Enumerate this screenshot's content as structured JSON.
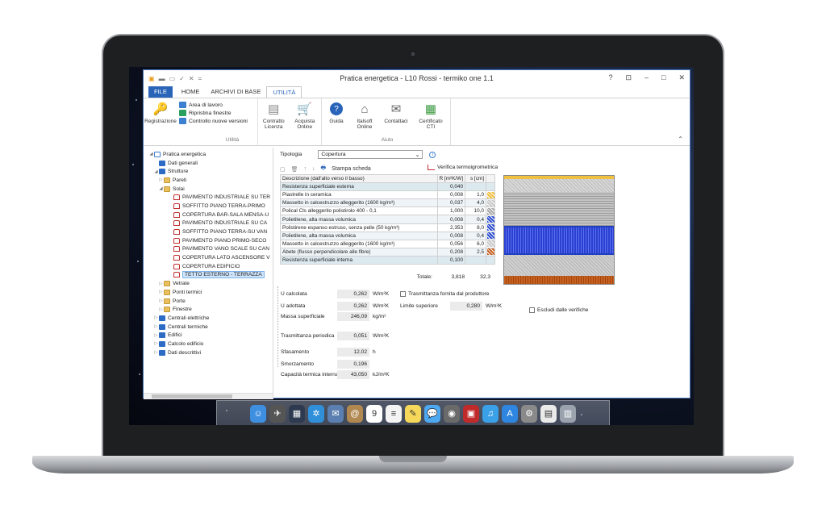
{
  "window": {
    "title": "Pratica energetica - L10 Rossi - termiko one 1.1",
    "controls": [
      "?",
      "⊡",
      "–",
      "□",
      "✕"
    ]
  },
  "quick_access": [
    "▣",
    "▬",
    "▭",
    "✓",
    "✕",
    "="
  ],
  "tabs": [
    {
      "label": "FILE"
    },
    {
      "label": "HOME"
    },
    {
      "label": "ARCHIVI DI BASE"
    },
    {
      "label": "UTILITÀ"
    }
  ],
  "ribbon": {
    "utilita_group": {
      "label": "Utilità",
      "registrazione": "Registrazione",
      "area_di_lavoro": "Area di lavoro",
      "ripristina_finestre": "Ripristina finestre",
      "controllo_nuove_versioni": "Controllo nuove versioni",
      "contratto_licenza": "Contratto Licenza",
      "acquista_online": "Acquista Online"
    },
    "aiuto_group": {
      "label": "Aiuto",
      "guida": "Guida",
      "italsoft_online": "Italsoft Online",
      "contattaci": "Contattaci",
      "certificato_cti": "Certificato CTI"
    }
  },
  "tree": [
    {
      "label": "Pratica energetica",
      "icon": "doc-icon",
      "arrow": "◢"
    },
    {
      "label": "Dati generali",
      "icon": "blue-book-icon",
      "arrow": ""
    },
    {
      "label": "Strutture",
      "icon": "blue-book-icon",
      "arrow": "◢"
    },
    {
      "label": "Pareti",
      "icon": "folder-icon",
      "arrow": "▷"
    },
    {
      "label": "Solai",
      "icon": "folder-icon",
      "arrow": "◢"
    },
    {
      "label": "PAVIMENTO INDUSTRIALE SU TER",
      "icon": "slab-icon",
      "arrow": ""
    },
    {
      "label": "SOFFITTO PIANO TERRA-PRIMO",
      "icon": "slab-icon",
      "arrow": ""
    },
    {
      "label": "COPERTURA BAR-SALA MENSA-U",
      "icon": "slab-icon",
      "arrow": ""
    },
    {
      "label": "PAVIMENTO INDUSTRIALE SU CA",
      "icon": "slab-icon",
      "arrow": ""
    },
    {
      "label": "SOFFITTO PIANO TERRA-SU VAN",
      "icon": "slab-icon",
      "arrow": ""
    },
    {
      "label": "PAVIMENTO PIANO PRIMO-SECO",
      "icon": "slab-icon",
      "arrow": ""
    },
    {
      "label": "PAVIMENTO VANO SCALE SU CAN",
      "icon": "slab-icon",
      "arrow": ""
    },
    {
      "label": "COPERTURA LATO ASCENSORE V",
      "icon": "slab-icon",
      "arrow": ""
    },
    {
      "label": "COPERTURA EDIFICIO",
      "icon": "slab-icon",
      "arrow": ""
    },
    {
      "label": "TETTO ESTERNO - TERRAZZA",
      "icon": "slab-icon",
      "arrow": "",
      "selected": true
    },
    {
      "label": "Vetrate",
      "icon": "folder-icon",
      "arrow": "▷"
    },
    {
      "label": "Ponti termici",
      "icon": "folder-icon",
      "arrow": "▷"
    },
    {
      "label": "Porte",
      "icon": "folder-icon",
      "arrow": "▷"
    },
    {
      "label": "Finestre",
      "icon": "folder-icon",
      "arrow": "▷"
    },
    {
      "label": "Centrali elettriche",
      "icon": "blue-book-icon",
      "arrow": "▷"
    },
    {
      "label": "Centrali termiche",
      "icon": "blue-book-icon",
      "arrow": "▷"
    },
    {
      "label": "Edifici",
      "icon": "blue-book-icon",
      "arrow": "▷"
    },
    {
      "label": "Calcolo edificio",
      "icon": "blue-book-icon",
      "arrow": "▷"
    },
    {
      "label": "Dati descrittivi",
      "icon": "blue-book-icon",
      "arrow": "▷"
    }
  ],
  "tipologia": {
    "label": "Tipologia",
    "value": "Copertura"
  },
  "toolbar": {
    "stampa_scheda": "Stampa scheda",
    "verifica": "Verifica termoigrometrica"
  },
  "layers": {
    "headers": {
      "desc": "Descrizione (dall'alto verso il basso)",
      "r": "R [m²K/W]",
      "s": "s [cm]"
    },
    "rows": [
      {
        "desc": "Resistenza superficiale esterna",
        "r": "0,040",
        "s": "",
        "kind": "surf",
        "pattern": ""
      },
      {
        "desc": "Piastrelle in ceramica",
        "r": "0,008",
        "s": "1,0",
        "kind": "",
        "pattern": "#f0c040"
      },
      {
        "desc": "Massetto in calcestruzzo alleggerito (1600 kg/m³)",
        "r": "0,037",
        "s": "4,0",
        "kind": "alt",
        "pattern": "#c8c8c8"
      },
      {
        "desc": "Polical Cls alleggerito polistirolo 400 - 0,1",
        "r": "1,000",
        "s": "10,0",
        "kind": "",
        "pattern": "#a8a8a8"
      },
      {
        "desc": "Polietilene, alta massa volumica",
        "r": "0,008",
        "s": "0,4",
        "kind": "alt",
        "pattern": "#3050d0"
      },
      {
        "desc": "Polistirene espanso estruso, senza pelle (50 kg/m³)",
        "r": "2,353",
        "s": "8,0",
        "kind": "",
        "pattern": "#3050d0"
      },
      {
        "desc": "Polietilene, alta massa volumica",
        "r": "0,008",
        "s": "0,4",
        "kind": "alt",
        "pattern": "#3050d0"
      },
      {
        "desc": "Massetto in calcestruzzo alleggerito (1600 kg/m³)",
        "r": "0,056",
        "s": "6,0",
        "kind": "",
        "pattern": "#c8c8c8"
      },
      {
        "desc": "Abete (flusso perpendicolare alle fibre)",
        "r": "0,208",
        "s": "2,5",
        "kind": "alt",
        "pattern": "#c86020"
      },
      {
        "desc": "Resistenza superficiale interna",
        "r": "0,100",
        "s": "",
        "kind": "surf",
        "pattern": ""
      }
    ],
    "totals": {
      "label": "Totale:",
      "r": "3,818",
      "s": "32,3"
    }
  },
  "params": {
    "u_calcolata": {
      "label": "U calcolata",
      "value": "0,262",
      "unit": "W/m²K"
    },
    "u_adottata": {
      "label": "U adottata",
      "value": "0,262",
      "unit": "W/m²K"
    },
    "massa": {
      "label": "Massa superficiale",
      "value": "246,09",
      "unit": "kg/m²"
    },
    "trasmittanza": {
      "label": "Trasmittanza periodica",
      "value": "0,051",
      "unit": "W/m²K"
    },
    "sfasamento": {
      "label": "Sfasamento",
      "value": "12,02",
      "unit": "h"
    },
    "smorzamento": {
      "label": "Smorzamento",
      "value": "0,196",
      "unit": ""
    },
    "capacita": {
      "label": "Capacità termica interna",
      "value": "43,050",
      "unit": "kJ/m²K"
    },
    "trasm_fornita": "Trasmittanza fornita dal produttore",
    "limite": {
      "label": "Limite superiore",
      "value": "0,280",
      "unit": "W/m²K"
    },
    "escludi": "Escludi dalle verifiche"
  },
  "dock": [
    {
      "name": "finder-icon",
      "color": "#3f8fe0",
      "glyph": "☺"
    },
    {
      "name": "launchpad-icon",
      "color": "#555",
      "glyph": "✈"
    },
    {
      "name": "mission-control-icon",
      "color": "#2d3a50",
      "glyph": "▦"
    },
    {
      "name": "safari-icon",
      "color": "#2f8fd8",
      "glyph": "✲"
    },
    {
      "name": "mail-icon",
      "color": "#5a7fb0",
      "glyph": "✉"
    },
    {
      "name": "contacts-icon",
      "color": "#b08850",
      "glyph": "@"
    },
    {
      "name": "calendar-icon",
      "color": "#ffffff",
      "glyph": "9"
    },
    {
      "name": "reminders-icon",
      "color": "#f4f4f4",
      "glyph": "≡"
    },
    {
      "name": "notes-icon",
      "color": "#f5d75a",
      "glyph": "✎"
    },
    {
      "name": "messages-icon",
      "color": "#4ea8f0",
      "glyph": "💬"
    },
    {
      "name": "facetime-icon",
      "color": "#6a6a6a",
      "glyph": "◉"
    },
    {
      "name": "photo-booth-icon",
      "color": "#c02a2a",
      "glyph": "▣"
    },
    {
      "name": "itunes-icon",
      "color": "#3aa0e8",
      "glyph": "♫"
    },
    {
      "name": "app-store-icon",
      "color": "#2f86e0",
      "glyph": "A"
    },
    {
      "name": "system-preferences-icon",
      "color": "#8a8a8a",
      "glyph": "⚙"
    },
    {
      "name": "documents-icon",
      "color": "#eaeaea",
      "glyph": "▤"
    },
    {
      "name": "trash-icon",
      "color": "#9aa3ad",
      "glyph": "▥"
    }
  ]
}
